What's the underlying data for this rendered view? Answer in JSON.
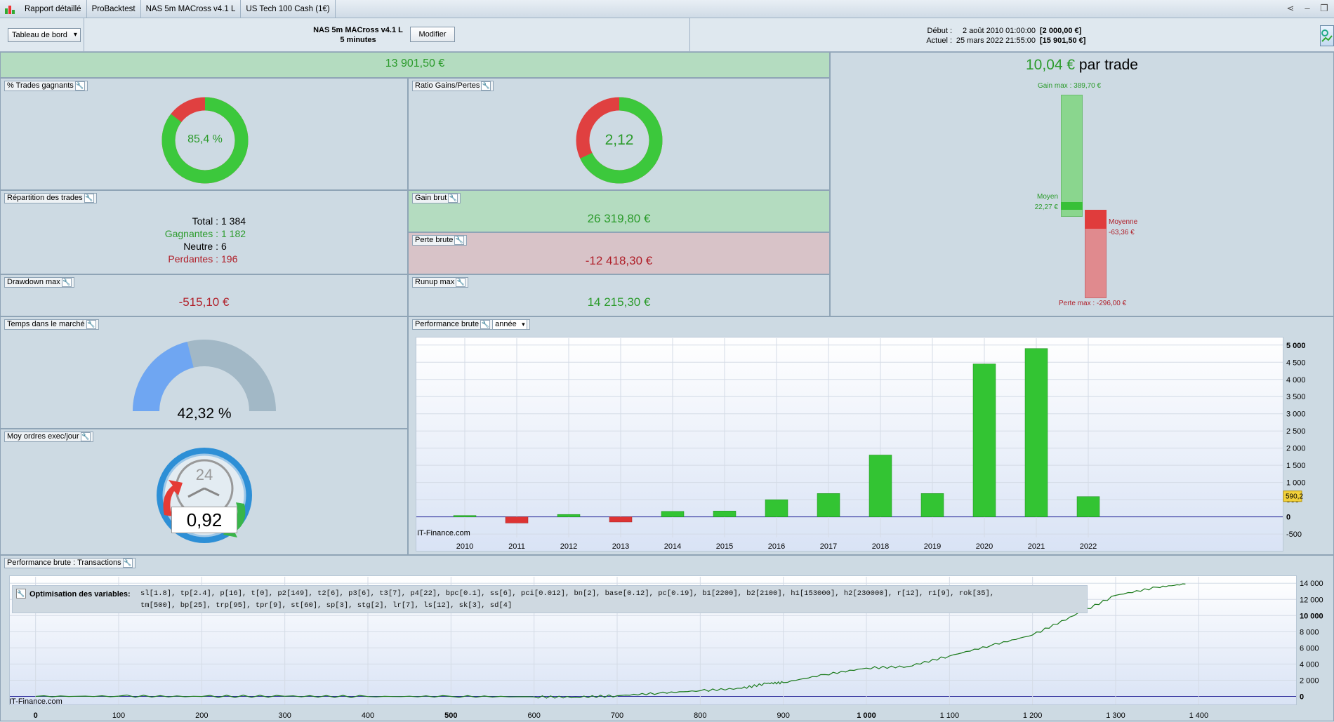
{
  "window": {
    "tabs": [
      "Rapport détaillé",
      "ProBacktest",
      "NAS 5m MACross v4.1 L",
      "US Tech 100 Cash (1€)"
    ]
  },
  "header": {
    "dashboard_label": "Tableau de bord",
    "strategy_name": "NAS 5m MACross v4.1 L",
    "timeframe": "5 minutes",
    "modify_label": "Modifier",
    "start_label": "Début :",
    "start_date": "2 août 2010 01:00:00",
    "start_capital": "[2 000,00 €]",
    "end_label": "Actuel :",
    "end_date": "25 mars 2022 21:55:00",
    "end_capital": "[15 901,50 €]"
  },
  "summary": {
    "net_gain": "13 901,50 €",
    "per_trade_value": "10,04 €",
    "per_trade_suffix": "par trade"
  },
  "win_pct": {
    "title": "% Trades gagnants",
    "value": "85,4 %",
    "fraction": 0.854,
    "color_win": "#3cc83c",
    "color_loss": "#e04040"
  },
  "ratio": {
    "title": "Ratio Gains/Pertes",
    "value": "2,12",
    "fraction": 0.68,
    "color_win": "#3cc83c",
    "color_loss": "#e04040"
  },
  "repartition": {
    "title": "Répartition des trades",
    "total_label": "Total :",
    "total_value": "1 384",
    "winners_label": "Gagnantes :",
    "winners_value": "1 182",
    "neutral_label": "Neutre :",
    "neutral_value": "6",
    "losers_label": "Perdantes :",
    "losers_value": "196"
  },
  "gross_gain": {
    "title": "Gain brut",
    "value": "26 319,80 €"
  },
  "gross_loss": {
    "title": "Perte brute",
    "value": "-12 418,30 €"
  },
  "drawdown": {
    "title": "Drawdown max",
    "value": "-515,10 €"
  },
  "runup": {
    "title": "Runup max",
    "value": "14 215,30 €"
  },
  "trade_bars": {
    "gain_max_label": "Gain max : 389,70 €",
    "avg_win_label": "Moyen",
    "avg_win_value": "22,27 €",
    "avg_loss_label": "Moyenne",
    "avg_loss_value": "-63,36 €",
    "loss_max_label": "Perte max : -296,00 €",
    "gain_max": 389.7,
    "avg_win": 22.27,
    "avg_loss": -63.36,
    "loss_max": -296.0
  },
  "market_time": {
    "title": "Temps dans le marché",
    "value": "42,32 %",
    "fraction": 0.4232
  },
  "orders": {
    "title": "Moy ordres exec/jour",
    "value": "0,92",
    "clock_label": "24"
  },
  "perf_year": {
    "title": "Performance brute",
    "period": "année",
    "watermark": "IT-Finance.com",
    "current_value_label": "590,2"
  },
  "perf_trades": {
    "title": "Performance brute : Transactions",
    "watermark": "IT-Finance.com",
    "opt_label": "Optimisation des variables:",
    "opt_line1": "sl[1.8], tp[2.4], p[16], t[0], p2[149], t2[6], p3[6], t3[7], p4[22], bpc[0.1], ss[6], pci[0.012], bn[2], base[0.12], pc[0.19], b1[2200], b2[2100], h1[153000], h2[230000], r[12], r1[9], rok[35],",
    "opt_line2": "tm[500], bp[25], trp[95], tpr[9], st[60], sp[3], stg[2], lr[7], ls[12], sk[3], sd[4]"
  },
  "chart_data": [
    {
      "type": "bar",
      "title": "Performance brute",
      "categories": [
        "2010",
        "2011",
        "2012",
        "2013",
        "2014",
        "2015",
        "2016",
        "2017",
        "2018",
        "2019",
        "2020",
        "2021",
        "2022"
      ],
      "values": [
        40,
        -180,
        70,
        -150,
        160,
        170,
        500,
        680,
        1800,
        680,
        4450,
        4900,
        590.2
      ],
      "ylim": [
        -600,
        5200
      ],
      "yticks": [
        5000,
        4500,
        4000,
        3500,
        3000,
        2500,
        2000,
        1500,
        1000,
        500,
        0,
        -500
      ],
      "ytick_labels": [
        "5 000",
        "4 500",
        "4 000",
        "3 500",
        "3 000",
        "2 500",
        "2 000",
        "1 500",
        "1 000",
        "500",
        "0",
        "-500"
      ],
      "bold_ticks": [
        5000,
        0
      ],
      "colors": {
        "positive": "#33c433",
        "negative": "#dd3333"
      },
      "grid": true
    },
    {
      "type": "line",
      "title": "Performance brute : Transactions",
      "x": [
        0,
        100,
        200,
        300,
        400,
        500,
        600,
        650,
        700,
        750,
        800,
        850,
        880,
        900,
        950,
        1000,
        1050,
        1100,
        1150,
        1200,
        1250,
        1300,
        1350,
        1384
      ],
      "y": [
        0,
        30,
        -10,
        20,
        -20,
        0,
        -60,
        -100,
        80,
        400,
        700,
        1000,
        1600,
        1700,
        2700,
        3500,
        3700,
        5000,
        6300,
        7600,
        10000,
        12500,
        13500,
        13900
      ],
      "ylim": [
        -1000,
        14800
      ],
      "xlim": [
        -20,
        1480
      ],
      "xticks": [
        0,
        100,
        200,
        300,
        400,
        500,
        600,
        700,
        800,
        900,
        1000,
        1100,
        1200,
        1300,
        1400
      ],
      "xtick_labels": [
        "0",
        "100",
        "200",
        "300",
        "400",
        "500",
        "600",
        "700",
        "800",
        "900",
        "1 000",
        "1 100",
        "1 200",
        "1 300",
        "1 400"
      ],
      "yticks": [
        14000,
        12000,
        10000,
        8000,
        6000,
        4000,
        2000,
        0
      ],
      "ytick_labels": [
        "14 000",
        "12 000",
        "10 000",
        "8 000",
        "6 000",
        "4 000",
        "2 000",
        "0"
      ],
      "color": "#1a7a1a",
      "grid": true
    }
  ]
}
